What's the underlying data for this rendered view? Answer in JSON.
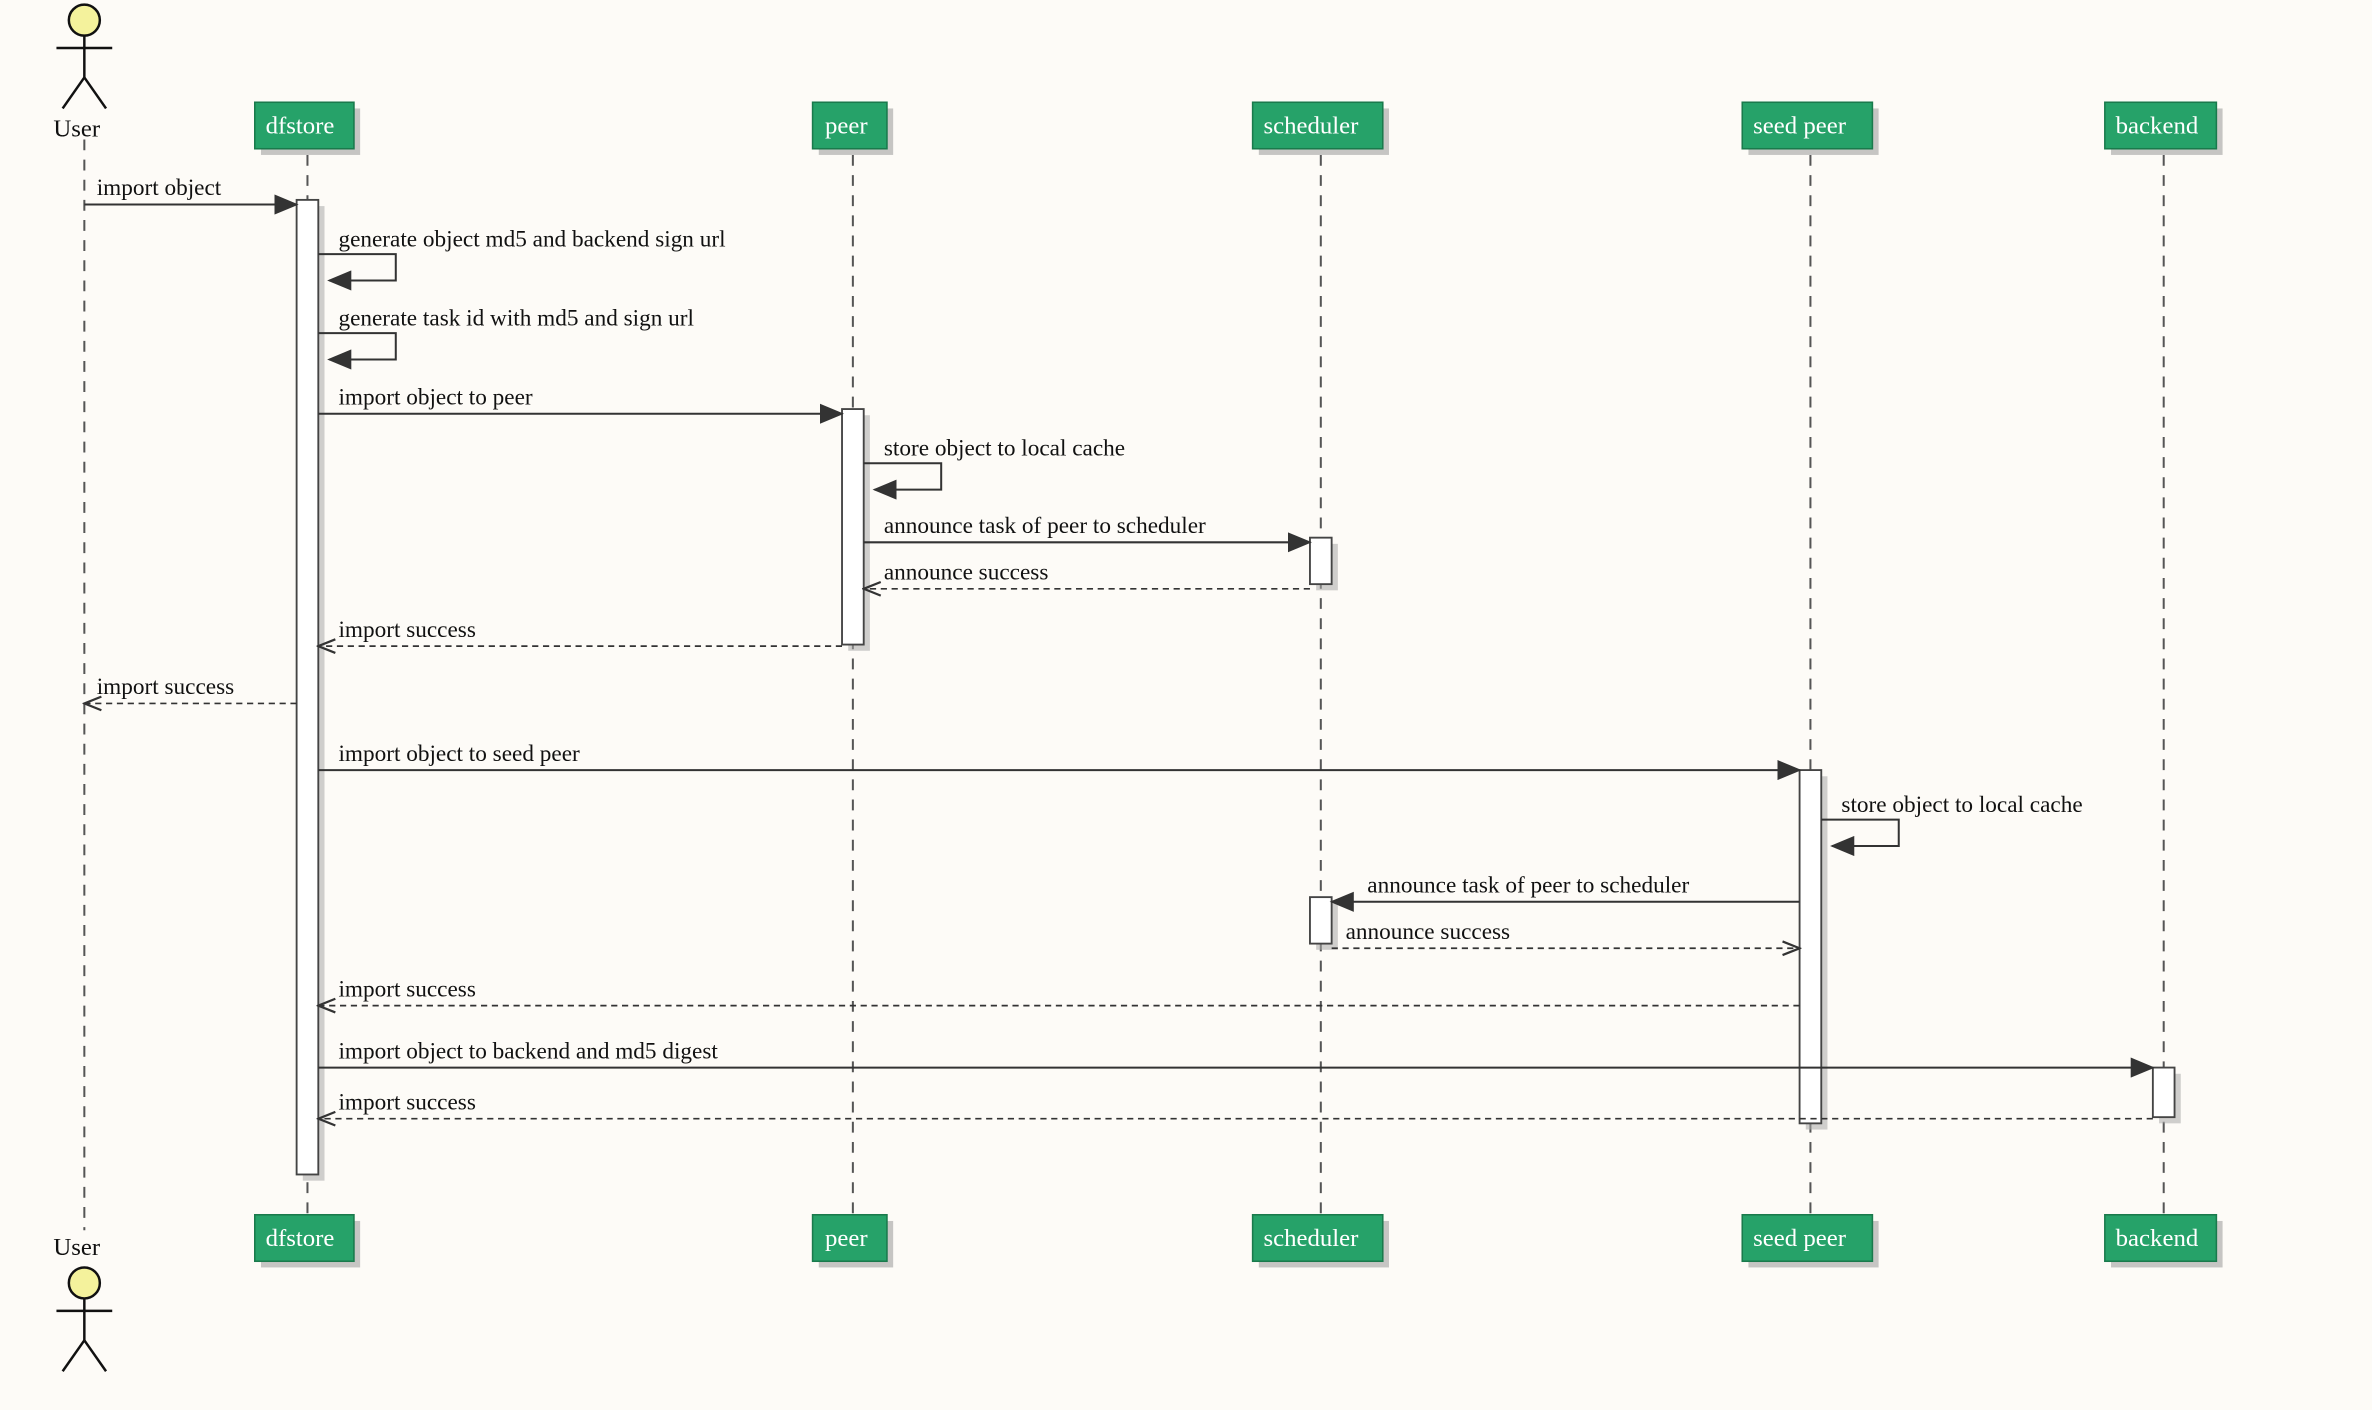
{
  "actors": {
    "user_top": "User",
    "user_bot": "User"
  },
  "participants": {
    "dfstore": "dfstore",
    "peer": "peer",
    "scheduler": "scheduler",
    "seedpeer": "seed peer",
    "backend": "backend"
  },
  "messages": {
    "m1": "import object",
    "m2": "generate object md5 and backend sign url",
    "m3": "generate task id with md5 and sign url",
    "m4": "import object to peer",
    "m5": "store object to local cache",
    "m6": "announce task of peer to scheduler",
    "m7": "announce success",
    "m8": "import success",
    "m9": "import success",
    "m10": "import object to seed peer",
    "m11": "store object to local cache",
    "m12": "announce task of peer to scheduler",
    "m13": "announce success",
    "m14": "import success",
    "m15": "import object to backend and md5 digest",
    "m16": "import success"
  }
}
